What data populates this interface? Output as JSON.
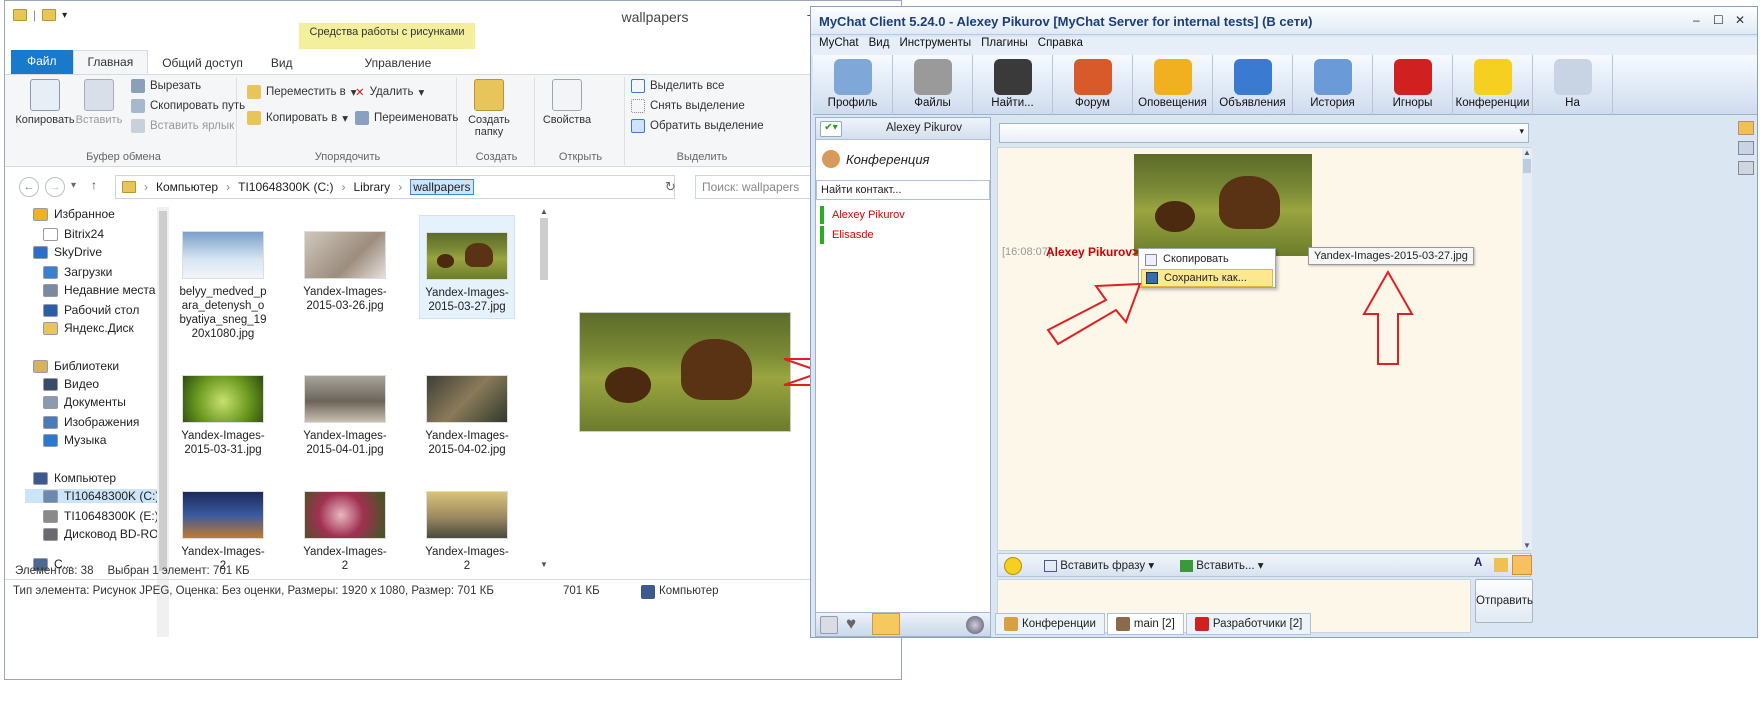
{
  "explorer": {
    "window_title": "wallpapers",
    "context_tab_header": "Средства работы с рисунками",
    "ribbon_tabs": [
      "Файл",
      "Главная",
      "Общий доступ",
      "Вид",
      "Управление"
    ],
    "groups": {
      "clipboard": {
        "title": "Буфер обмена",
        "copy": "Копировать",
        "paste": "Вставить",
        "cut": "Вырезать",
        "copy_path": "Скопировать путь",
        "paste_shortcut": "Вставить ярлык"
      },
      "organize": {
        "title": "Упорядочить",
        "move_to": "Переместить в",
        "copy_to": "Копировать в",
        "delete": "Удалить",
        "rename": "Переименовать"
      },
      "new": {
        "title": "Создать",
        "new_folder": "Создать папку"
      },
      "open": {
        "title": "Открыть",
        "properties": "Свойства"
      },
      "select": {
        "title": "Выделить",
        "select_all": "Выделить все",
        "select_none": "Снять выделение",
        "invert": "Обратить выделение"
      }
    },
    "address": [
      "Компьютер",
      "TI10648300K (C:)",
      "Library",
      "wallpapers"
    ],
    "search_placeholder": "Поиск: wallpapers",
    "tree": [
      {
        "label": "Избранное",
        "icon": "star-icon",
        "color": "#f0b020"
      },
      {
        "label": "Bitrix24",
        "icon": "file-icon",
        "color": "#ffffff"
      },
      {
        "label": "SkyDrive",
        "icon": "cloud-icon",
        "color": "#2a6fc9"
      },
      {
        "label": "Загрузки",
        "icon": "downloads-icon",
        "color": "#3a7fd0"
      },
      {
        "label": "Недавние места",
        "icon": "recent-icon",
        "color": "#7a8aa0"
      },
      {
        "label": "Рабочий стол",
        "icon": "desktop-icon",
        "color": "#2a5fa8"
      },
      {
        "label": "Яндекс.Диск",
        "icon": "folder-icon",
        "color": "#e8c55a"
      },
      {
        "label": "Библиотеки",
        "icon": "libraries-icon",
        "color": "#d6b35a"
      },
      {
        "label": "Видео",
        "icon": "video-icon",
        "color": "#3a4a6a"
      },
      {
        "label": "Документы",
        "icon": "documents-icon",
        "color": "#8a9ab0"
      },
      {
        "label": "Изображения",
        "icon": "pictures-icon",
        "color": "#4a7ab8"
      },
      {
        "label": "Музыка",
        "icon": "music-icon",
        "color": "#2a7ad0"
      },
      {
        "label": "Компьютер",
        "icon": "computer-icon",
        "color": "#3a5a90"
      },
      {
        "label": "TI10648300K (C:)",
        "icon": "drive-icon",
        "color": "#6a8ab0"
      },
      {
        "label": "TI10648300K (E:)",
        "icon": "drive-icon",
        "color": "#8a8a8a"
      },
      {
        "label": "Дисковод BD-RO",
        "icon": "bd-drive-icon",
        "color": "#6a6a6a"
      },
      {
        "label": "С...",
        "icon": "network-icon",
        "color": "#4a6a90"
      }
    ],
    "files": [
      {
        "name": "belyy_medved_para_detenysh_obyatiya_sneg_1920x1080.jpg",
        "img": "img-ice"
      },
      {
        "name": "Yandex-Images-2015-03-26.jpg",
        "img": "img-bird"
      },
      {
        "name": "Yandex-Images-2015-03-27.jpg",
        "img": "img-bear",
        "selected": true
      },
      {
        "name": "Yandex-Images-2015-03-31.jpg",
        "img": "img-grass"
      },
      {
        "name": "Yandex-Images-2015-04-01.jpg",
        "img": "img-seal"
      },
      {
        "name": "Yandex-Images-2015-04-02.jpg",
        "img": "img-water"
      },
      {
        "name": "Yandex-Images-2",
        "img": "img-city"
      },
      {
        "name": "Yandex-Images-2",
        "img": "img-flower"
      },
      {
        "name": "Yandex-Images-2",
        "img": "img-sky"
      }
    ],
    "status_items": "Элементов: 38",
    "status_selected": "Выбран 1 элемент: 701 КБ",
    "details": "Тип элемента: Рисунок JPEG, Оценка: Без оценки, Размеры: 1920 x 1080, Размер: 701 КБ",
    "details_size": "701 КБ",
    "details_location": "Компьютер"
  },
  "mychat": {
    "title": "MyChat Client 5.24.0 - Alexey Pikurov [MyChat Server for internal tests] (В сети)",
    "menu": [
      "MyChat",
      "Вид",
      "Инструменты",
      "Плагины",
      "Справка"
    ],
    "toolbar": [
      {
        "label": "Профиль",
        "icon": "profile-icon",
        "color": "#7fa7d8"
      },
      {
        "label": "Файлы",
        "icon": "files-icon",
        "color": "#9a9a9a"
      },
      {
        "label": "Найти...",
        "icon": "binoculars-icon",
        "color": "#3a3a3a"
      },
      {
        "label": "Форум",
        "icon": "forum-icon",
        "color": "#d85a2a"
      },
      {
        "label": "Оповещения",
        "icon": "megaphone-icon",
        "color": "#f0b020"
      },
      {
        "label": "Объявления",
        "icon": "announcements-icon",
        "color": "#3a7ad0"
      },
      {
        "label": "История",
        "icon": "calendar-icon",
        "color": "#6a9ad8"
      },
      {
        "label": "Игноры",
        "icon": "stop-icon",
        "color": "#d02020"
      },
      {
        "label": "Конференции",
        "icon": "star-icon",
        "color": "#f5d020"
      },
      {
        "label": "На",
        "icon": "more-icon",
        "color": "#c8d4e4"
      }
    ],
    "user_name": "Alexey Pikurov",
    "conference_label": "Конференция",
    "find_contact": "Найти контакт...",
    "contacts": [
      "Alexey Pikurov",
      "Elisasde"
    ],
    "message": {
      "time": "[16:08:07]",
      "user": "Alexey Pikurov>"
    },
    "context_menu": {
      "copy": "Скопировать",
      "save_as": "Сохранить как..."
    },
    "tooltip": "Yandex-Images-2015-03-27.jpg",
    "insert_phrase": "Вставить фразу",
    "insert": "Вставить...",
    "send": "Отправить",
    "tabs": [
      {
        "label": "Конференции",
        "icon": "home-icon"
      },
      {
        "label": "main [2]",
        "icon": "group-icon",
        "active": true
      },
      {
        "label": "Разработчики [2]",
        "icon": "lock-icon"
      }
    ]
  }
}
